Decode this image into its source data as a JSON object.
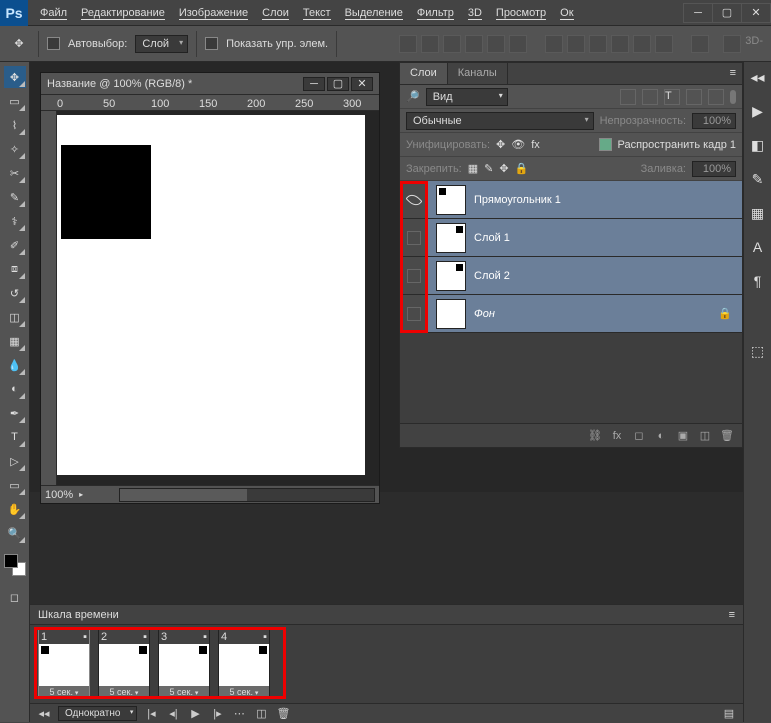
{
  "app": {
    "logo": "Ps"
  },
  "menu": [
    "Файл",
    "Редактирование",
    "Изображение",
    "Слои",
    "Текст",
    "Выделение",
    "Фильтр",
    "3D",
    "Просмотр",
    "Ок"
  ],
  "options": {
    "autoselect_label": "Автовыбор:",
    "autoselect_value": "Слой",
    "show_controls_label": "Показать упр. элем.",
    "threeD_label": "3D-"
  },
  "document": {
    "title": "Название @ 100% (RGB/8) *",
    "ruler_marks": [
      "0",
      "50",
      "100",
      "150",
      "200",
      "250",
      "300"
    ],
    "zoom": "100%"
  },
  "layers_panel": {
    "tabs": [
      "Слои",
      "Каналы"
    ],
    "filter_kind": "Вид",
    "blend_mode": "Обычные",
    "opacity_label": "Непрозрачность:",
    "opacity_value": "100%",
    "unify_label": "Унифицировать:",
    "propagate_label": "Распространить кадр 1",
    "lock_label": "Закрепить:",
    "fill_label": "Заливка:",
    "fill_value": "100%",
    "layers": [
      {
        "name": "Прямоугольник 1",
        "visible": true,
        "locked": false
      },
      {
        "name": "Слой 1",
        "visible": false,
        "locked": false
      },
      {
        "name": "Слой 2",
        "visible": false,
        "locked": false
      },
      {
        "name": "Фон",
        "visible": false,
        "locked": true,
        "italic": true
      }
    ]
  },
  "timeline": {
    "title": "Шкала времени",
    "frames": [
      {
        "n": "1",
        "time": "5 сек.",
        "dot_pos": "tl"
      },
      {
        "n": "2",
        "time": "5 сек.",
        "dot_pos": "tr"
      },
      {
        "n": "3",
        "time": "5 сек.",
        "dot_pos": "tr"
      },
      {
        "n": "4",
        "time": "5 сек.",
        "dot_pos": "tr"
      }
    ],
    "loop": "Однократно"
  }
}
